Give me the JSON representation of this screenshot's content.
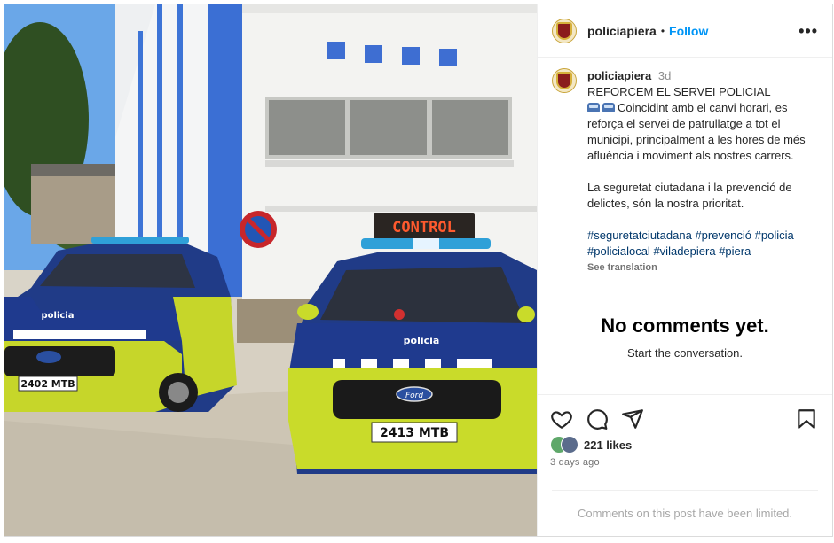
{
  "colors": {
    "accent": "#0095f6",
    "hashtag": "#00376b",
    "muted": "#737373"
  },
  "header": {
    "username": "policiapiera",
    "separator": "•",
    "follow_label": "Follow",
    "more_icon": "more-horizontal-icon"
  },
  "caption": {
    "username": "policiapiera",
    "time": "3d",
    "headline": "REFORCEM EL SERVEI POLICIAL",
    "paragraph1": "Coincidint amb el canvi horari, es reforça el servei de patrullatge a tot el municipi, principalment a les hores de més afluència i moviment als nostres carrers.",
    "paragraph2": "La seguretat ciutadana i la prevenció de delictes, són la nostra prioritat.",
    "hashtags": [
      "#seguretatciutadana",
      "#prevenció",
      "#policia",
      "#policialocal",
      "#viladepiera",
      "#piera"
    ],
    "see_translation": "See translation"
  },
  "comments": {
    "empty_title": "No comments yet.",
    "empty_subtitle": "Start the conversation."
  },
  "actions": {
    "likes": "221 likes",
    "time_ago": "3 days ago",
    "limited_notice": "Comments on this post have been limited."
  },
  "photo": {
    "sign_text": "CONTROL",
    "car_left_badge": "policia",
    "car_left_plate": "2402 MTB",
    "car_right_badge": "policia",
    "car_right_plate": "2413 MTB",
    "ford_logo": "Ford",
    "side_text": "policia"
  }
}
